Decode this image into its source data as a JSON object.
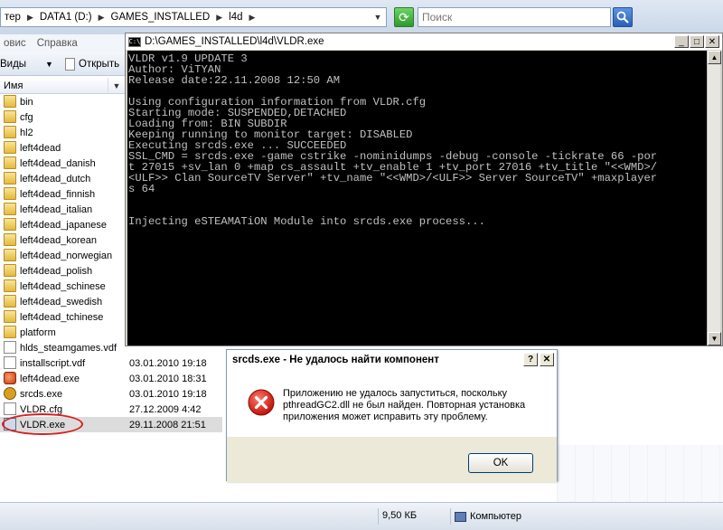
{
  "explorer": {
    "breadcrumbs": [
      "тер",
      "DATA1 (D:)",
      "GAMES_INSTALLED",
      "l4d"
    ],
    "search_placeholder": "Поиск",
    "menu": [
      "овис",
      "Справка"
    ],
    "toolbar": {
      "views_label": "Виды",
      "open_label": "Открыть"
    },
    "column_name": "Имя",
    "files": [
      {
        "name": "bin",
        "type": "folder",
        "date": ""
      },
      {
        "name": "cfg",
        "type": "folder",
        "date": ""
      },
      {
        "name": "hl2",
        "type": "folder",
        "date": ""
      },
      {
        "name": "left4dead",
        "type": "folder",
        "date": ""
      },
      {
        "name": "left4dead_danish",
        "type": "folder",
        "date": ""
      },
      {
        "name": "left4dead_dutch",
        "type": "folder",
        "date": ""
      },
      {
        "name": "left4dead_finnish",
        "type": "folder",
        "date": ""
      },
      {
        "name": "left4dead_italian",
        "type": "folder",
        "date": ""
      },
      {
        "name": "left4dead_japanese",
        "type": "folder",
        "date": ""
      },
      {
        "name": "left4dead_korean",
        "type": "folder",
        "date": ""
      },
      {
        "name": "left4dead_norwegian",
        "type": "folder",
        "date": ""
      },
      {
        "name": "left4dead_polish",
        "type": "folder",
        "date": ""
      },
      {
        "name": "left4dead_schinese",
        "type": "folder",
        "date": ""
      },
      {
        "name": "left4dead_swedish",
        "type": "folder",
        "date": ""
      },
      {
        "name": "left4dead_tchinese",
        "type": "folder",
        "date": ""
      },
      {
        "name": "platform",
        "type": "folder",
        "date": ""
      },
      {
        "name": "hlds_steamgames.vdf",
        "type": "file",
        "date": ""
      },
      {
        "name": "installscript.vdf",
        "type": "file",
        "date": "03.01.2010 19:18"
      },
      {
        "name": "left4dead.exe",
        "type": "exe",
        "date": "03.01.2010 18:31"
      },
      {
        "name": "srcds.exe",
        "type": "hl",
        "date": "03.01.2010 19:18"
      },
      {
        "name": "VLDR.cfg",
        "type": "file",
        "date": "27.12.2009 4:42"
      },
      {
        "name": "VLDR.exe",
        "type": "app",
        "date": "29.11.2008 21:51"
      }
    ],
    "status": {
      "size": "9,50 КБ",
      "location": "Компьютер"
    }
  },
  "console": {
    "title": "D:\\GAMES_INSTALLED\\l4d\\VLDR.exe",
    "icon_label": "C:\\",
    "lines": [
      "VLDR v1.9 UPDATE 3",
      "Author: ViTYAN",
      "Release date:22.11.2008 12:50 AM",
      "",
      "Using configuration information from VLDR.cfg",
      "Starting mode: SUSPENDED,DETACHED",
      "Loading from: BIN SUBDIR",
      "Keeping running to monitor target: DISABLED",
      "Executing srcds.exe ... SUCCEEDED",
      "SSL_CMD = srcds.exe -game cstrike -nominidumps -debug -console -tickrate 66 -por",
      "t 27015 +sv_lan 0 +map cs_assault +tv_enable 1 +tv_port 27016 +tv_title \"<<WMD>/",
      "<ULF>> Clan SourceTV Server\" +tv_name \"<<WMD>/<ULF>> Server SourceTV\" +maxplayer",
      "s 64",
      "",
      "",
      "Injecting eSTEAMATiON Module into srcds.exe process..."
    ]
  },
  "dialog": {
    "title": "srcds.exe - Не удалось найти компонент",
    "message_lines": [
      "Приложению не удалось запуститься, поскольку",
      "pthreadGC2.dll не был найден. Повторная установка",
      "приложения может исправить эту проблему."
    ],
    "ok_label": "OK"
  }
}
